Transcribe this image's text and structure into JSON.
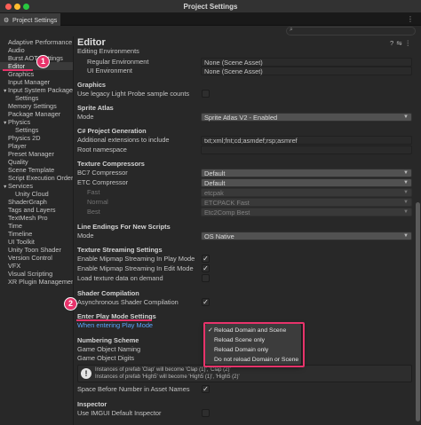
{
  "window": {
    "title": "Project Settings"
  },
  "tab": {
    "label": "Project Settings"
  },
  "sidebar": {
    "items": [
      {
        "label": "Adaptive Performance"
      },
      {
        "label": "Audio"
      },
      {
        "label": "Burst AOT Settings"
      },
      {
        "label": "Editor"
      },
      {
        "label": "Graphics"
      },
      {
        "label": "Input Manager"
      },
      {
        "label": "Input System Package"
      },
      {
        "label": "Settings"
      },
      {
        "label": "Memory Settings"
      },
      {
        "label": "Package Manager"
      },
      {
        "label": "Physics"
      },
      {
        "label": "Settings"
      },
      {
        "label": "Physics 2D"
      },
      {
        "label": "Player"
      },
      {
        "label": "Preset Manager"
      },
      {
        "label": "Quality"
      },
      {
        "label": "Scene Template"
      },
      {
        "label": "Script Execution Order"
      },
      {
        "label": "Services"
      },
      {
        "label": "Unity Cloud"
      },
      {
        "label": "ShaderGraph"
      },
      {
        "label": "Tags and Layers"
      },
      {
        "label": "TextMesh Pro"
      },
      {
        "label": "Time"
      },
      {
        "label": "Timeline"
      },
      {
        "label": "UI Toolkit"
      },
      {
        "label": "Unity Toon Shader"
      },
      {
        "label": "Version Control"
      },
      {
        "label": "VFX"
      },
      {
        "label": "Visual Scripting"
      },
      {
        "label": "XR Plugin Management"
      }
    ]
  },
  "editor": {
    "title": "Editor",
    "editing_env": {
      "header": "Editing Environments",
      "regular_label": "Regular Environment",
      "regular_value": "None (Scene Asset)",
      "ui_label": "UI Environment",
      "ui_value": "None (Scene Asset)"
    },
    "graphics": {
      "header": "Graphics",
      "legacy_label": "Use legacy Light Probe sample counts"
    },
    "sprite_atlas": {
      "header": "Sprite Atlas",
      "mode_label": "Mode",
      "mode_value": "Sprite Atlas V2 - Enabled"
    },
    "csharp": {
      "header": "C# Project Generation",
      "ext_label": "Additional extensions to include",
      "ext_value": "txt;xml;fnt;cd;asmdef;rsp;asmref",
      "ns_label": "Root namespace",
      "ns_value": ""
    },
    "texture_compressors": {
      "header": "Texture Compressors",
      "bc7_label": "BC7 Compressor",
      "bc7_value": "Default",
      "etc_label": "ETC Compressor",
      "etc_value": "Default",
      "fast_label": "Fast",
      "fast_value": "etcpak",
      "normal_label": "Normal",
      "normal_value": "ETCPACK Fast",
      "best_label": "Best",
      "best_value": "Etc2Comp Best"
    },
    "line_endings": {
      "header": "Line Endings For New Scripts",
      "mode_label": "Mode",
      "mode_value": "OS Native"
    },
    "texture_streaming": {
      "header": "Texture Streaming Settings",
      "play_label": "Enable Mipmap Streaming In Play Mode",
      "edit_label": "Enable Mipmap Streaming In Edit Mode",
      "load_label": "Load texture data on demand"
    },
    "shader": {
      "header": "Shader Compilation",
      "async_label": "Asynchronous Shader Compilation"
    },
    "play_mode": {
      "header": "Enter Play Mode Settings",
      "when_label": "When entering Play Mode",
      "options": [
        {
          "label": "Reload Domain and Scene",
          "check": "✓"
        },
        {
          "label": "Reload Scene only",
          "check": ""
        },
        {
          "label": "Reload Domain only",
          "check": ""
        },
        {
          "label": "Do not reload Domain or Scene",
          "check": ""
        }
      ]
    },
    "numbering": {
      "header": "Numbering Scheme",
      "name_label": "Game Object Naming",
      "digits_label": "Game Object Digits",
      "help_line1": "Instances of prefab 'Clap' will become 'Clap (1)', 'Clap (2)'",
      "help_line2": "Instances of prefab 'High5' will become 'High5 (1)', 'High5 (2)'",
      "space_label": "Space Before Number in Asset Names"
    },
    "inspector": {
      "header": "Inspector",
      "imgui_label": "Use IMGUI Default Inspector"
    }
  },
  "annotations": {
    "badge1": "1",
    "badge2": "2"
  },
  "icons": {
    "gear": "gear-icon",
    "search": "search-icon",
    "help": "help-icon",
    "preset": "preset-icon",
    "more": "more-icon",
    "check": "check-icon",
    "warning": "warning-icon"
  },
  "colors": {
    "accent_pink": "#e8336b",
    "link_blue": "#5aa7ff",
    "selection": "#3a3a3a"
  }
}
